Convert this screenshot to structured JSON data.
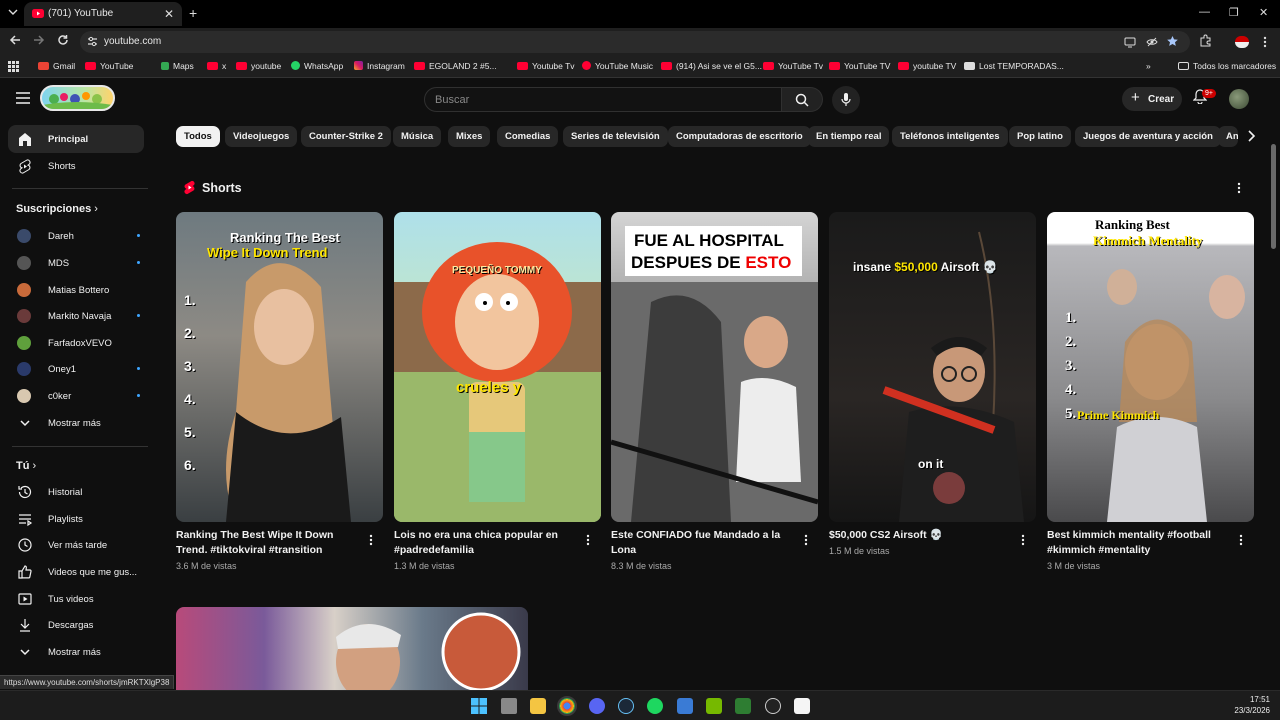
{
  "browser": {
    "tab_title": "(701) YouTube",
    "url": "youtube.com",
    "status_url": "https://www.youtube.com/shorts/jmRKTXlgP38",
    "bookmarks": [
      "Gmail",
      "YouTube",
      "Maps",
      "x",
      "youtube",
      "WhatsApp",
      "Instagram",
      "EGOLAND 2 #5...",
      "Youtube Tv",
      "YouTube Music",
      "(914) Asi se ve el G5...",
      "YouTube Tv",
      "YouTube TV",
      "youtube TV",
      "Lost TEMPORADAS..."
    ],
    "all_bookmarks": "Todos los marcadores"
  },
  "header": {
    "search_placeholder": "Buscar",
    "create_label": "Crear",
    "notifications_badge": "9+"
  },
  "sidebar": {
    "main": [
      {
        "label": "Principal",
        "icon": "home-icon",
        "active": true
      },
      {
        "label": "Shorts",
        "icon": "shorts-icon",
        "active": false
      }
    ],
    "subscriptions_title": "Suscripciones",
    "subscriptions": [
      {
        "label": "Dareh",
        "color": "#3a4a6a"
      },
      {
        "label": "MDS",
        "color": "#555555"
      },
      {
        "label": "Matias Bottero",
        "color": "#c86a3a"
      },
      {
        "label": "Markito Navaja",
        "color": "#6a3a3a"
      },
      {
        "label": "FarfadoxVEVO",
        "color": "#5fa03c"
      },
      {
        "label": "Oney1",
        "color": "#2a3a6a"
      },
      {
        "label": "c0ker",
        "color": "#d8c8b0"
      }
    ],
    "show_more": "Mostrar más",
    "you_title": "Tú",
    "you_items": [
      {
        "label": "Historial",
        "icon": "history-icon"
      },
      {
        "label": "Playlists",
        "icon": "playlists-icon"
      },
      {
        "label": "Ver más tarde",
        "icon": "watch-later-icon"
      },
      {
        "label": "Videos que me gus...",
        "icon": "like-icon"
      },
      {
        "label": "Tus videos",
        "icon": "your-videos-icon"
      },
      {
        "label": "Descargas",
        "icon": "download-icon"
      }
    ],
    "show_more_2": "Mostrar más"
  },
  "chips": [
    "Todos",
    "Videojuegos",
    "Counter-Strike 2",
    "Música",
    "Mixes",
    "Comedias",
    "Series de televisión",
    "Computadoras de escritorio",
    "En tiempo real",
    "Teléfonos inteligentes",
    "Pop latino",
    "Juegos de aventura y acción",
    "Ani"
  ],
  "shorts": {
    "section_title": "Shorts",
    "items": [
      {
        "title": "Ranking The Best Wipe It Down Trend. #tiktokviral #transition",
        "views": "3.6 M de vistas",
        "overlay1": "Ranking The Best",
        "overlay2": "Wipe It Down Trend",
        "ranks": [
          "1.",
          "2.",
          "3.",
          "4.",
          "5.",
          "6."
        ]
      },
      {
        "title": "Lois no era una chica popular en #padredefamilia",
        "views": "1.3 M de vistas",
        "overlay1": "PEQUEÑO TOMMY",
        "overlay2": "crueles y"
      },
      {
        "title": "Este CONFIADO fue Mandado a la Lona",
        "views": "8.3 M de vistas",
        "overlay1": "FUE AL HOSPITAL",
        "overlay2a": "DESPUES DE ",
        "overlay2b": "ESTO"
      },
      {
        "title": "$50,000 CS2 Airsoft 💀",
        "views": "1.5 M de vistas",
        "overlay1a": "insane ",
        "overlay1b": "$50,000",
        "overlay1c": " Airsoft 💀",
        "overlay2": "on it"
      },
      {
        "title": "Best kimmich mentality #football #kimmich #mentality",
        "views": "3 M de vistas",
        "overlay1": "Ranking Best",
        "overlay2": "Kimmich Mentality",
        "ranks": [
          "1.",
          "2.",
          "3.",
          "4.",
          "5."
        ],
        "overlay3": "Prime Kimmich"
      }
    ]
  },
  "clock": {
    "time": "17:51",
    "date": "23/3/2026"
  }
}
